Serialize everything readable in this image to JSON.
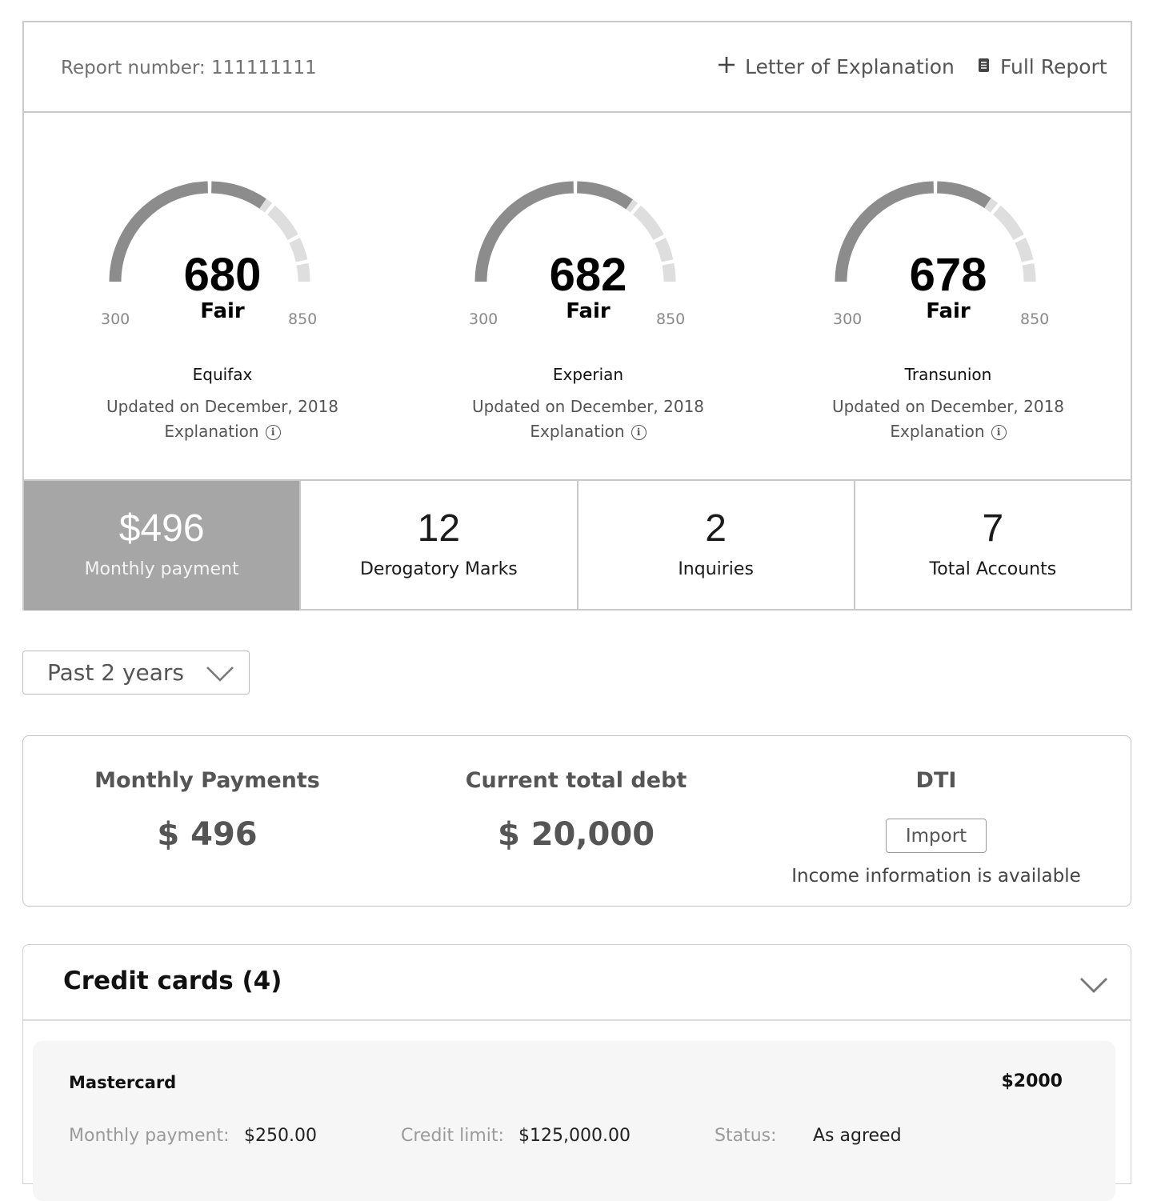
{
  "header": {
    "report_number": "Report number: 111111111",
    "letter_label": "Letter of Explanation",
    "full_report_label": "Full Report"
  },
  "gauges": [
    {
      "bureau": "Equifax",
      "score": "680",
      "rating": "Fair",
      "min": "300",
      "max": "850",
      "score_value": 680,
      "updated": "Updated on December, 2018",
      "explanation": "Explanation"
    },
    {
      "bureau": "Experian",
      "score": "682",
      "rating": "Fair",
      "min": "300",
      "max": "850",
      "score_value": 682,
      "updated": "Updated on December, 2018",
      "explanation": "Explanation"
    },
    {
      "bureau": "Transunion",
      "score": "678",
      "rating": "Fair",
      "min": "300",
      "max": "850",
      "score_value": 678,
      "updated": "Updated on December, 2018",
      "explanation": "Explanation"
    }
  ],
  "tiles": [
    {
      "value": "$496",
      "label": "Monthly payment"
    },
    {
      "value": "12",
      "label": "Derogatory Marks"
    },
    {
      "value": "2",
      "label": "Inquiries"
    },
    {
      "value": "7",
      "label": "Total Accounts"
    }
  ],
  "range": {
    "selected": "Past 2 years"
  },
  "summary": {
    "monthly_heading": "Monthly Payments",
    "monthly_value": "$ 496",
    "debt_heading": "Current total debt",
    "debt_value": "$ 20,000",
    "dti_heading": "DTI",
    "import_label": "Import",
    "import_note": "Income information is available"
  },
  "credit_cards": {
    "title": "Credit cards (4)",
    "items": [
      {
        "name": "Mastercard",
        "amount": "$2000",
        "monthly_label": "Monthly payment:",
        "monthly_value": "$250.00",
        "limit_label": "Credit limit:",
        "limit_value": "$125,000.00",
        "status_label": "Status:",
        "status_value": "As agreed"
      }
    ]
  },
  "colors": {
    "gauge_filled": "#8c8c8c",
    "gauge_empty": "#dedede",
    "tile_highlight": "#a6a6a6"
  },
  "icons": {
    "letter": "plus-icon",
    "full_report": "document-icon",
    "range": "chevron-down-icon",
    "credit_cards": "chevron-down-icon",
    "explanation": "info-icon"
  }
}
